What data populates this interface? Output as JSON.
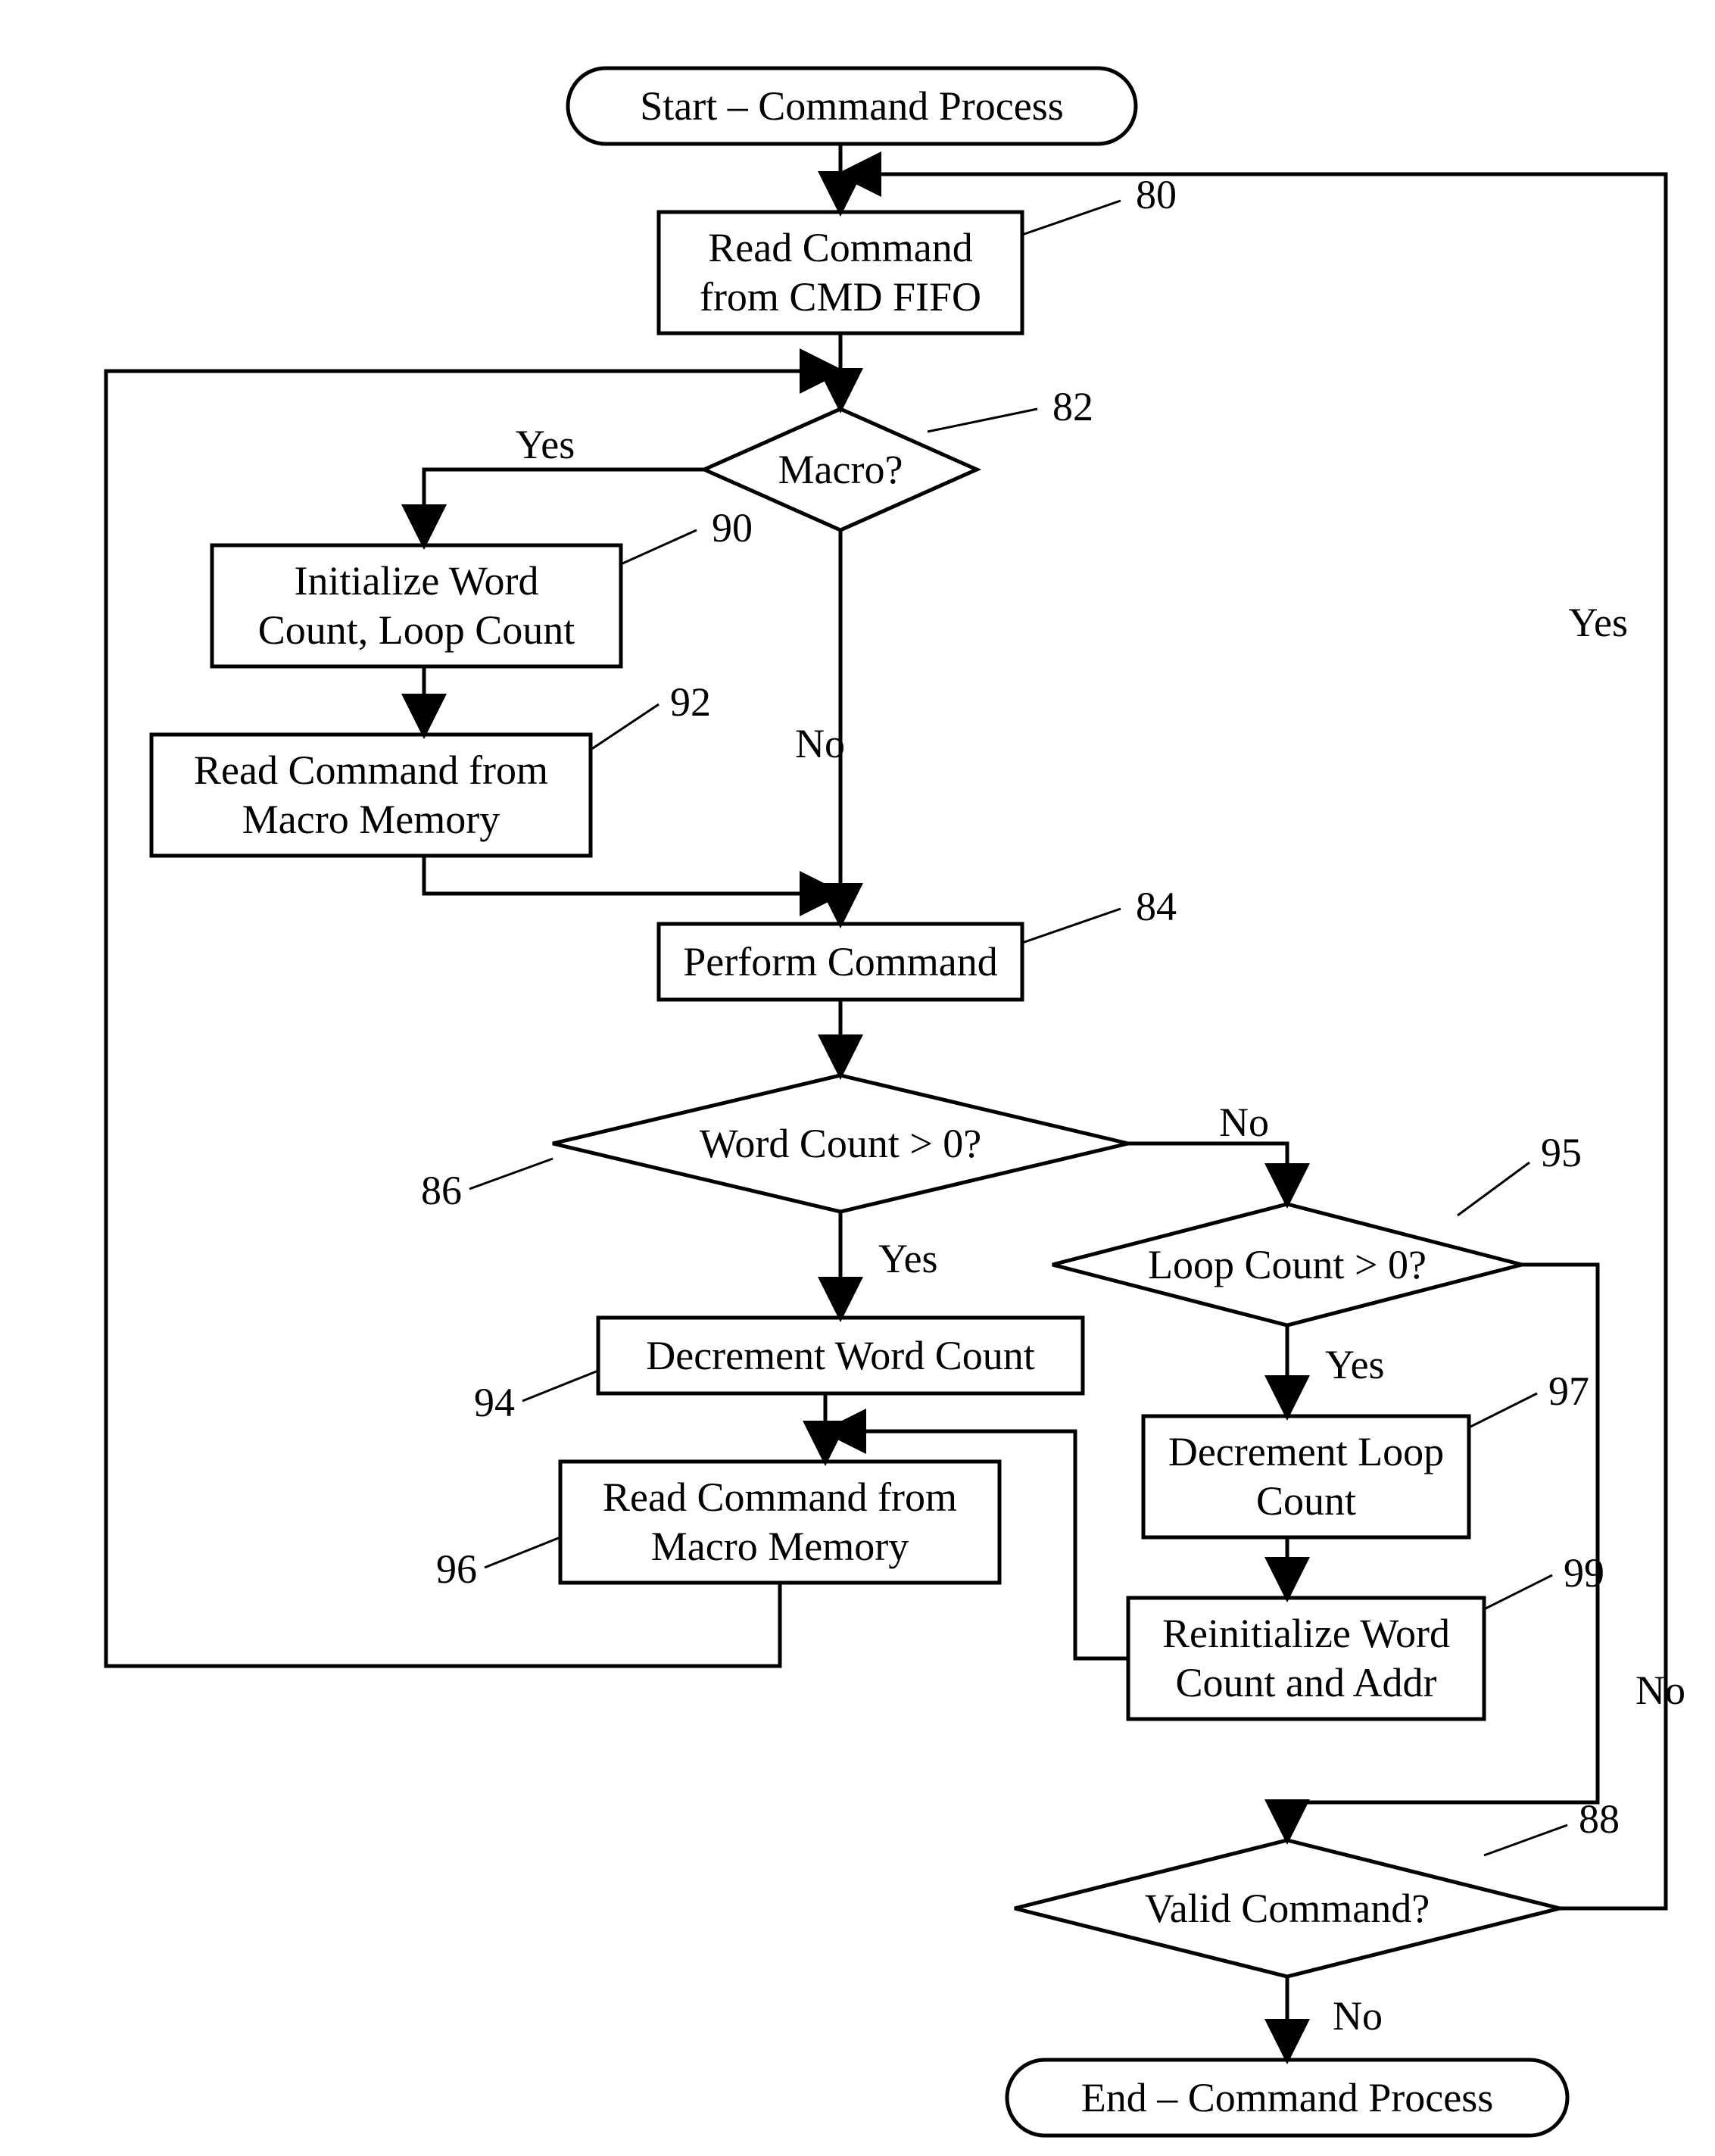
{
  "nodes": {
    "start": {
      "label": "Start – Command Process"
    },
    "n80": {
      "line1": "Read Command",
      "line2": "from CMD FIFO",
      "ref": "80"
    },
    "n82": {
      "label": "Macro?",
      "ref": "82"
    },
    "n90": {
      "line1": "Initialize Word",
      "line2": "Count, Loop Count",
      "ref": "90"
    },
    "n92": {
      "line1": "Read Command from",
      "line2": "Macro Memory",
      "ref": "92"
    },
    "n84": {
      "label": "Perform Command",
      "ref": "84"
    },
    "n86": {
      "label": "Word Count > 0?",
      "ref": "86"
    },
    "n95": {
      "label": "Loop Count > 0?",
      "ref": "95"
    },
    "n94": {
      "label": "Decrement Word Count",
      "ref": "94"
    },
    "n97": {
      "line1": "Decrement Loop",
      "line2": "Count",
      "ref": "97"
    },
    "n96": {
      "line1": "Read Command from",
      "line2": "Macro Memory",
      "ref": "96"
    },
    "n99": {
      "line1": "Reinitialize Word",
      "line2": "Count and Addr",
      "ref": "99"
    },
    "n88": {
      "label": "Valid Command?",
      "ref": "88"
    },
    "end": {
      "label": "End – Command Process"
    }
  },
  "edges": {
    "yes": "Yes",
    "no": "No"
  }
}
